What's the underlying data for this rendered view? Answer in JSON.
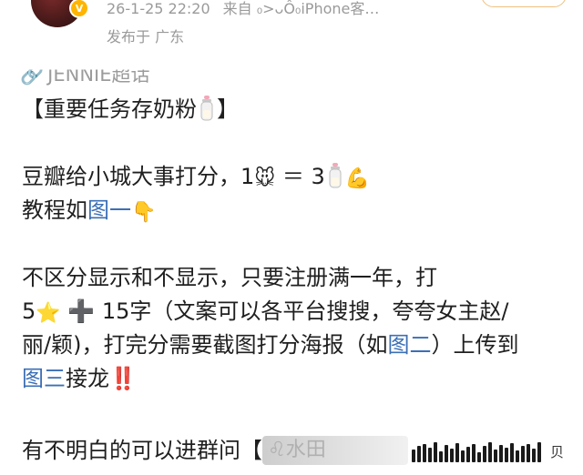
{
  "header": {
    "timestamp": "26-1-25 22:20",
    "source": "来自 ₀>ᴗÔ₀iPhone客…",
    "location": "发布于 广东"
  },
  "supertopic": {
    "label": "JENNIE超话"
  },
  "post": {
    "title_open": "【重要任务存奶粉",
    "title_close": "】",
    "line1_text": "豆瓣给小城大事打分，1",
    "line1_eq": " ＝ 3",
    "line2_text": "教程如",
    "line2_link": "图一",
    "line3_text": "不区分显示和不显示，只要注册满一年，打",
    "line4_num": "5",
    "line4_text": " ➕ 15字（文案可以各平台搜搜，夸夸女主赵/",
    "line5_text": "丽/颖)，打完分需要截图打分海报（如",
    "line5_link": "图二",
    "line5_tail": "）上传到",
    "line6_link": "图三",
    "line6_text": "接龙",
    "line6_mark": "‼️",
    "line7_text": "有不明白的可以进群问",
    "line7_bracket": "【",
    "line7_chip": "♌水田",
    "emoji": {
      "mouse": "🐭",
      "star": "⭐",
      "point_down": "👇",
      "muscle": "💪"
    }
  },
  "watermark": {
    "text": "贝"
  }
}
